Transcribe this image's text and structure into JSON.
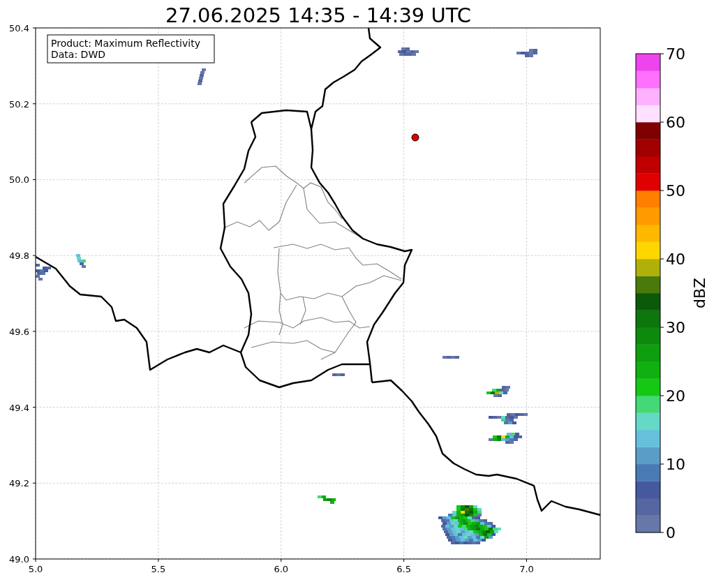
{
  "title": "27.06.2025 14:35 - 14:39 UTC",
  "legend": {
    "lines": [
      "Product: Maximum Reflectivity",
      "Data: DWD"
    ]
  },
  "x_axis": {
    "ticks": [
      "5.0",
      "5.5",
      "6.0",
      "6.5",
      "7.0"
    ]
  },
  "y_axis": {
    "ticks": [
      "50.4",
      "50.2",
      "50.0",
      "49.8",
      "49.6",
      "49.4",
      "49.2",
      "49.0"
    ]
  },
  "colorbar": {
    "label": "dBZ",
    "ticks": [
      "70",
      "60",
      "50",
      "40",
      "30",
      "20",
      "10",
      "0"
    ],
    "segments": [
      {
        "color": "#6677a8"
      },
      {
        "color": "#5566a0"
      },
      {
        "color": "#4558a0"
      },
      {
        "color": "#4a7ab4"
      },
      {
        "color": "#5a9ec8"
      },
      {
        "color": "#66c0dc"
      },
      {
        "color": "#66d8c8"
      },
      {
        "color": "#44d877"
      },
      {
        "color": "#14c814"
      },
      {
        "color": "#10b010"
      },
      {
        "color": "#0e9e0e"
      },
      {
        "color": "#0d8a0d"
      },
      {
        "color": "#0d760d"
      },
      {
        "color": "#0a5a0a"
      },
      {
        "color": "#4a7a0a"
      },
      {
        "color": "#b0b00a"
      },
      {
        "color": "#ffd700"
      },
      {
        "color": "#ffb800"
      },
      {
        "color": "#ff9a00"
      },
      {
        "color": "#ff7f00"
      },
      {
        "color": "#e00000"
      },
      {
        "color": "#c00000"
      },
      {
        "color": "#a00000"
      },
      {
        "color": "#7f0000"
      },
      {
        "color": "#ffe0ff"
      },
      {
        "color": "#ffb0ff"
      },
      {
        "color": "#ff70ff"
      },
      {
        "color": "#ee44ee"
      }
    ]
  }
}
